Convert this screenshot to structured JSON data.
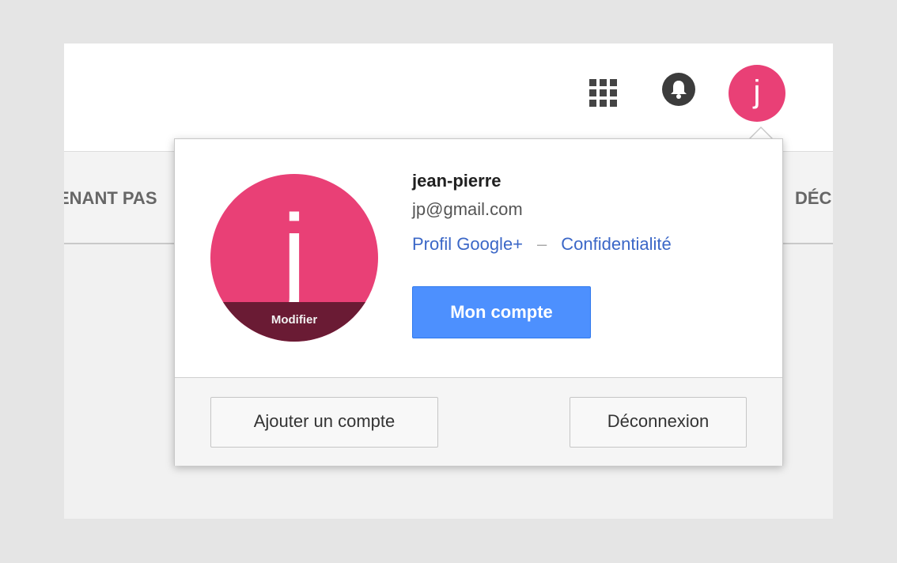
{
  "header": {
    "apps_icon": "apps-grid-icon",
    "notifications_icon": "bell-icon",
    "avatar_letter": "j"
  },
  "tabs": {
    "left_fragment": "ENANT PAS",
    "right_fragment": "DÉC"
  },
  "account_popup": {
    "avatar_letter": "j",
    "avatar_action": "Modifier",
    "name": "jean-pierre",
    "email": "jp@gmail.com",
    "links": {
      "profile": "Profil Google+",
      "separator": "–",
      "privacy": "Confidentialité"
    },
    "my_account_button": "Mon compte",
    "add_account_button": "Ajouter un compte",
    "sign_out_button": "Déconnexion"
  },
  "colors": {
    "avatar": "#e94076",
    "avatar_overlay": "#6a1b34",
    "primary_button": "#4d90fe",
    "link": "#3b67c7"
  }
}
